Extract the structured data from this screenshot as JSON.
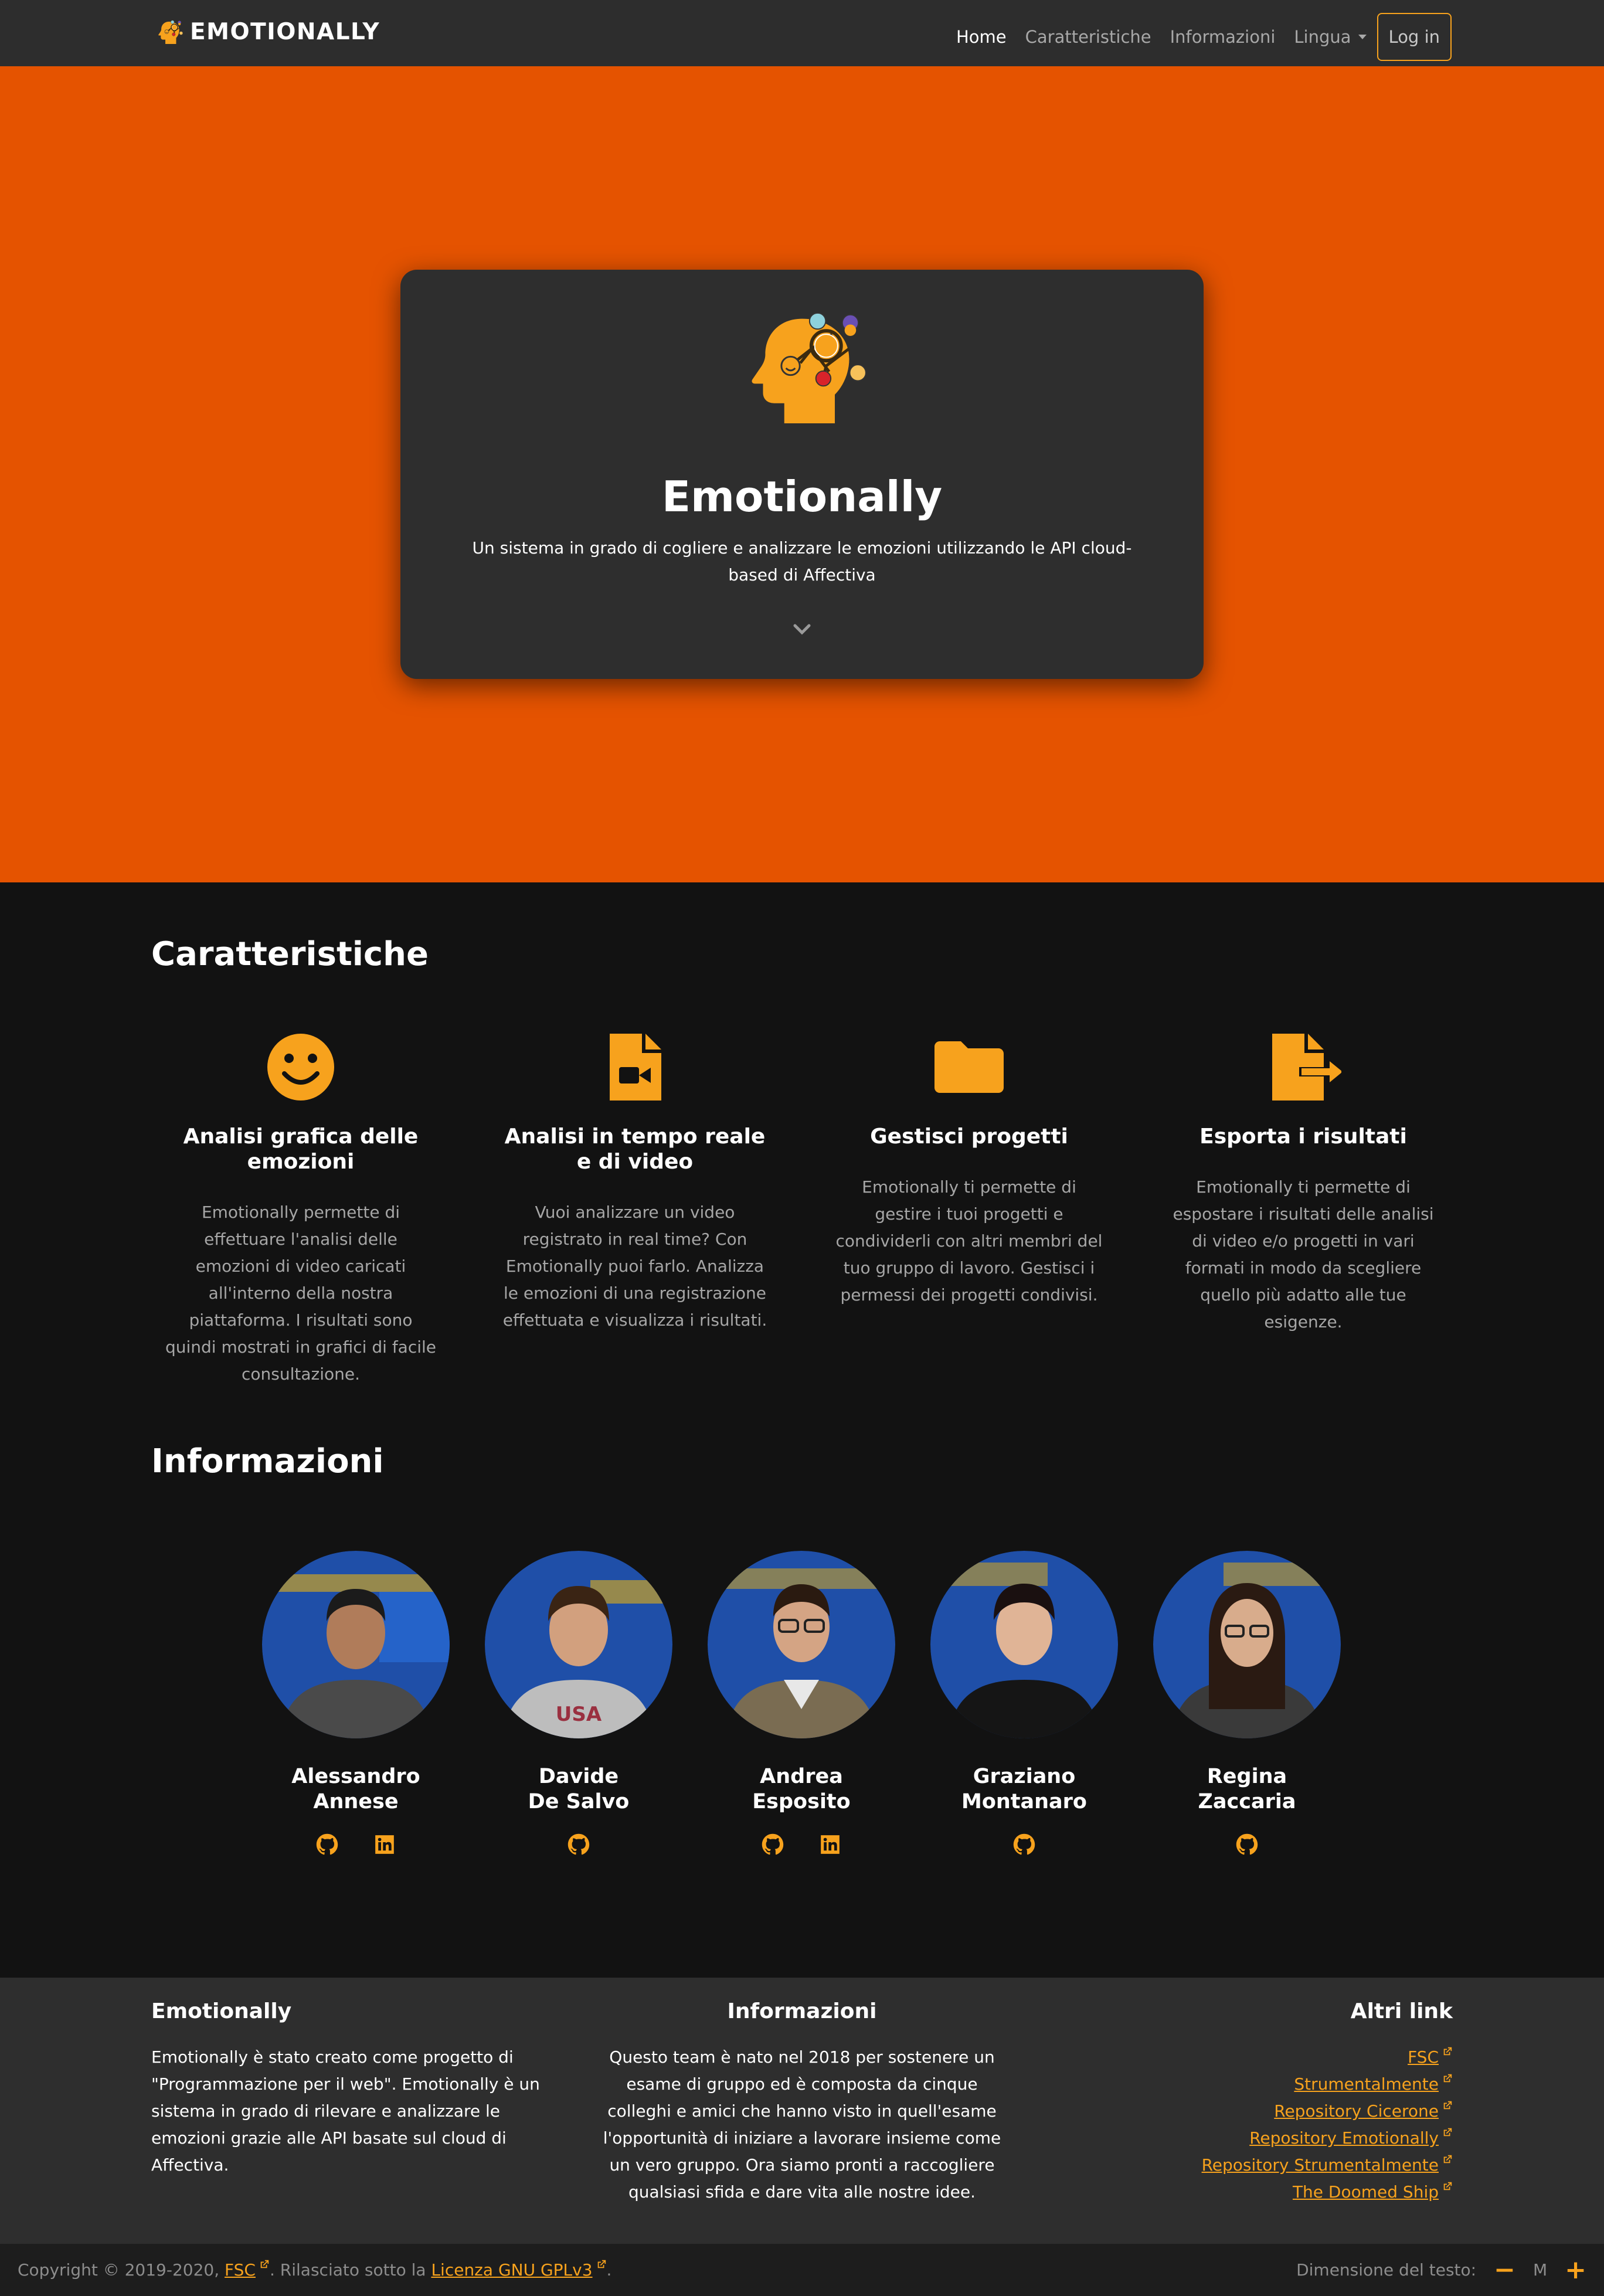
{
  "navbar": {
    "brand": "EMOTIONALLY",
    "links": [
      {
        "label": "Home",
        "active": true
      },
      {
        "label": "Caratteristiche",
        "active": false
      },
      {
        "label": "Informazioni",
        "active": false
      }
    ],
    "language_label": "Lingua",
    "login_label": "Log in"
  },
  "hero": {
    "title": "Emotionally",
    "subtitle": "Un sistema in grado di cogliere e analizzare le emozioni utilizzando le API cloud-based di Affectiva"
  },
  "features": {
    "title": "Caratteristiche",
    "items": [
      {
        "icon": "smile-icon",
        "title": "Analisi grafica delle emozioni",
        "desc": "Emotionally permette di effettuare l'analisi delle emozioni di video caricati all'interno della nostra piattaforma. I risultati sono quindi mostrati in grafici di facile consultazione."
      },
      {
        "icon": "file-video-icon",
        "title": "Analisi in tempo reale e di video",
        "desc": "Vuoi analizzare un video registrato in real time? Con Emotionally puoi farlo. Analizza le emozioni di una registrazione effettuata e visualizza i risultati."
      },
      {
        "icon": "folder-icon",
        "title": "Gestisci progetti",
        "desc": "Emotionally ti permette di gestire i tuoi progetti e condividerli con altri membri del tuo gruppo di lavoro. Gestisci i permessi dei progetti condivisi."
      },
      {
        "icon": "file-export-icon",
        "title": "Esporta i risultati",
        "desc": "Emotionally ti permette di espostare i risultati delle analisi di video e/o progetti in vari formati in modo da scegliere quello più adatto alle tue esigenze."
      }
    ]
  },
  "team": {
    "title": "Informazioni",
    "members": [
      {
        "first": "Alessandro",
        "last": "Annese",
        "github": true,
        "linkedin": true
      },
      {
        "first": "Davide",
        "last": "De Salvo",
        "github": true,
        "linkedin": false
      },
      {
        "first": "Andrea",
        "last": "Esposito",
        "github": true,
        "linkedin": true
      },
      {
        "first": "Graziano",
        "last": "Montanaro",
        "github": true,
        "linkedin": false
      },
      {
        "first": "Regina",
        "last": "Zaccaria",
        "github": true,
        "linkedin": false
      }
    ]
  },
  "footer": {
    "about_title": "Emotionally",
    "about_text": "Emotionally è stato creato come progetto di \"Programmazione per il web\". Emotionally è un sistema in grado di rilevare e analizzare le emozioni grazie alle API basate sul cloud di Affectiva.",
    "info_title": "Informazioni",
    "info_text": "Questo team è nato nel 2018 per sostenere un esame di gruppo ed è composta da cinque colleghi e amici che hanno visto in quell'esame l'opportunità di iniziare a lavorare insieme come un vero gruppo. Ora siamo pronti a raccogliere qualsiasi sfida e dare vita alle nostre idee.",
    "links_title": "Altri link",
    "links": [
      "FSC",
      "Strumentalmente",
      "Repository Cicerone",
      "Repository Emotionally",
      "Repository Strumentalmente",
      "The Doomed Ship"
    ]
  },
  "bottom": {
    "copyright_prefix": "Copyright © 2019-2020,",
    "copyright_fsc": "FSC",
    "copyright_mid": ". Rilasciato sotto la",
    "license": "Licenza GNU GPLv3",
    "copyright_end": ".",
    "textsize_label": "Dimensione del testo:",
    "textsize_decrease": "−",
    "textsize_value": "M",
    "textsize_increase": "+"
  },
  "colors": {
    "accent": "#f7a21d",
    "hero_bg": "#e55300",
    "page_bg": "#121212",
    "card_bg": "#2e2e2e"
  }
}
